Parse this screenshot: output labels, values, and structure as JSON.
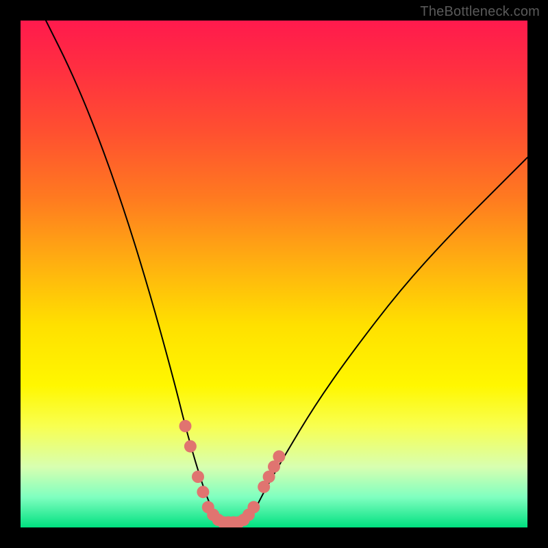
{
  "watermark": {
    "text": "TheBottleneck.com"
  },
  "chart_data": {
    "type": "line",
    "title": "",
    "xlabel": "",
    "ylabel": "",
    "xlim": [
      0,
      100
    ],
    "ylim": [
      0,
      100
    ],
    "series": [
      {
        "name": "bottleneck-curve",
        "x": [
          5,
          10,
          15,
          20,
          25,
          30,
          33,
          36,
          38,
          40,
          42,
          44,
          46,
          48,
          52,
          58,
          65,
          75,
          85,
          95,
          100
        ],
        "y": [
          100,
          90,
          78,
          64,
          48,
          30,
          18,
          8,
          3,
          1,
          1,
          1,
          3,
          7,
          14,
          24,
          34,
          47,
          58,
          68,
          73
        ]
      }
    ],
    "markers": {
      "name": "highlight-dots",
      "color": "#e07470",
      "points": [
        {
          "x": 32.5,
          "y": 20
        },
        {
          "x": 33.5,
          "y": 16
        },
        {
          "x": 35,
          "y": 10
        },
        {
          "x": 36,
          "y": 7
        },
        {
          "x": 37,
          "y": 4
        },
        {
          "x": 38,
          "y": 2.5
        },
        {
          "x": 39,
          "y": 1.5
        },
        {
          "x": 40,
          "y": 1
        },
        {
          "x": 41,
          "y": 1
        },
        {
          "x": 42,
          "y": 1
        },
        {
          "x": 43,
          "y": 1
        },
        {
          "x": 44,
          "y": 1.5
        },
        {
          "x": 45,
          "y": 2.5
        },
        {
          "x": 46,
          "y": 4
        },
        {
          "x": 48,
          "y": 8
        },
        {
          "x": 49,
          "y": 10
        },
        {
          "x": 50,
          "y": 12
        },
        {
          "x": 51,
          "y": 14
        }
      ]
    },
    "background_gradient": {
      "top": "#ff1a4d",
      "mid": "#ffe000",
      "bottom": "#00e080"
    }
  }
}
